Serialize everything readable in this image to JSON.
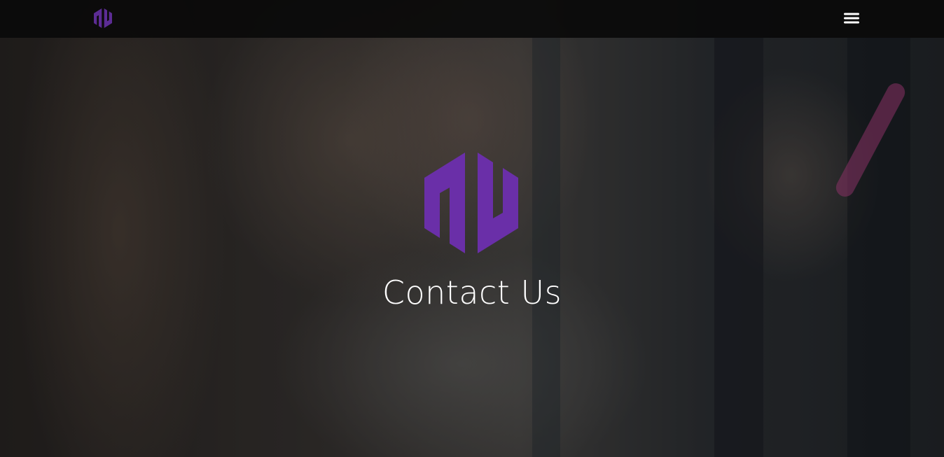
{
  "brand": {
    "name": "NU",
    "logo_color": "#6a2fa8",
    "nav_logo_color": "#5c2c94"
  },
  "navbar": {
    "background": "#0b0b0b",
    "menu_icon": "hamburger-menu-icon"
  },
  "hero": {
    "title": "Contact Us",
    "logo_icon": "nu-logo-icon",
    "text_color": "#ffffff"
  }
}
